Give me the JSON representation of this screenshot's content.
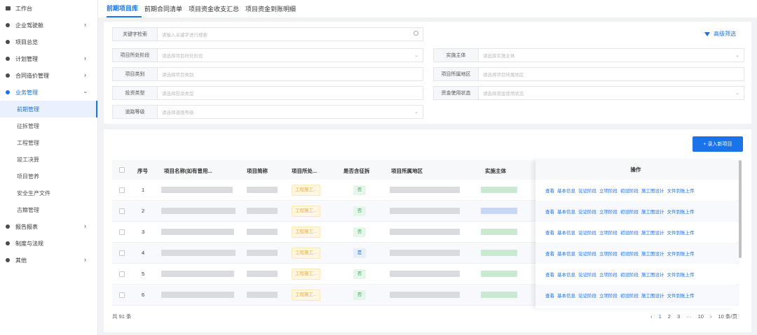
{
  "sidebar": {
    "items": [
      {
        "label": "工作台",
        "icon": "desktop-icon"
      },
      {
        "label": "企业驾驶舱",
        "icon": "dot-icon",
        "has_children": true
      },
      {
        "label": "项目总览",
        "icon": "dot-icon"
      },
      {
        "label": "计划管理",
        "icon": "dot-icon",
        "has_children": true
      },
      {
        "label": "合同造价管理",
        "icon": "dot-icon",
        "has_children": true
      },
      {
        "label": "业务管理",
        "icon": "dot-icon",
        "expanded": true
      }
    ],
    "sub_items": [
      "前期管理",
      "征拆管理",
      "工程管理",
      "竣工决算",
      "项目管养",
      "安全生产文件",
      "古籍管理"
    ],
    "bottom_items": [
      {
        "label": "报告报表",
        "has_children": true
      },
      {
        "label": "制度与法规"
      },
      {
        "label": "其他",
        "has_children": true
      }
    ]
  },
  "tabs": [
    "前期项目库",
    "前期合同清单",
    "项目资金收支汇总",
    "项目资金到账明细"
  ],
  "filters": {
    "keyword": {
      "label": "关键字检索",
      "placeholder": "请输入关键字进行搜索"
    },
    "stage": {
      "label": "项目所处阶段",
      "placeholder": "请选择项目所处阶段"
    },
    "category": {
      "label": "项目类别",
      "placeholder": "请选择项目类别"
    },
    "invest": {
      "label": "投资类型",
      "placeholder": "请选择投资类型"
    },
    "road": {
      "label": "道路等级",
      "placeholder": "请选择道路等级"
    },
    "entity": {
      "label": "实施主体",
      "placeholder": "请选择实施主体"
    },
    "region": {
      "label": "项目所属地区",
      "placeholder": "请选择项目所属地区"
    },
    "funds": {
      "label": "资金使用状态",
      "placeholder": "请选择资金使用状态"
    },
    "advanced": "高级筛选"
  },
  "add_button": "+ 录入新项目",
  "table": {
    "headers": [
      "序号",
      "项目名称(如有曾用...",
      "项目简称",
      "项目所处...",
      "是否含征拆",
      "项目所属地区",
      "实施主体",
      "操作"
    ],
    "rows": [
      {
        "no": "1",
        "stage": "工程施工...",
        "demolition": "否"
      },
      {
        "no": "2",
        "stage": "工程施工...",
        "demolition": "否"
      },
      {
        "no": "3",
        "stage": "工程施工...",
        "demolition": "否"
      },
      {
        "no": "4",
        "stage": "工程施工...",
        "demolition": "是"
      },
      {
        "no": "5",
        "stage": "工程施工...",
        "demolition": "否"
      },
      {
        "no": "6",
        "stage": "工程施工...",
        "demolition": "否"
      }
    ],
    "operations": [
      "查看",
      "基本信息",
      "论证阶段",
      "立项阶段",
      "初设阶段",
      "施工图设计",
      "文件到账上传"
    ]
  },
  "footer": {
    "total": "共 91 条",
    "pages": [
      "1",
      "2",
      "3",
      "···",
      "10"
    ],
    "page_size": "10 条/页"
  },
  "colors": {
    "accent": "#1a73e8"
  }
}
